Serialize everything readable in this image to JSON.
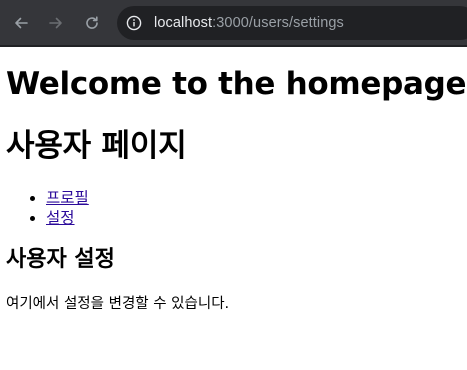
{
  "browser": {
    "url_host": "localhost",
    "url_path": ":3000/users/settings",
    "colors": {
      "toolbar": "#35363a",
      "omnibox": "#202124",
      "host_text": "#e8eaed",
      "path_text": "#9aa0a6",
      "icon": "#9aa0a6"
    },
    "icons": [
      "back-arrow-icon",
      "forward-arrow-icon",
      "reload-icon",
      "info-icon"
    ]
  },
  "page": {
    "heading_welcome": "Welcome to the homepage",
    "heading_user": "사용자 페이지",
    "nav_links": [
      {
        "label": "프로필"
      },
      {
        "label": "설정"
      }
    ],
    "section_title": "사용자 설정",
    "description": "여기에서 설정을 변경할 수 있습니다.",
    "link_color": "#2b0a9a"
  }
}
